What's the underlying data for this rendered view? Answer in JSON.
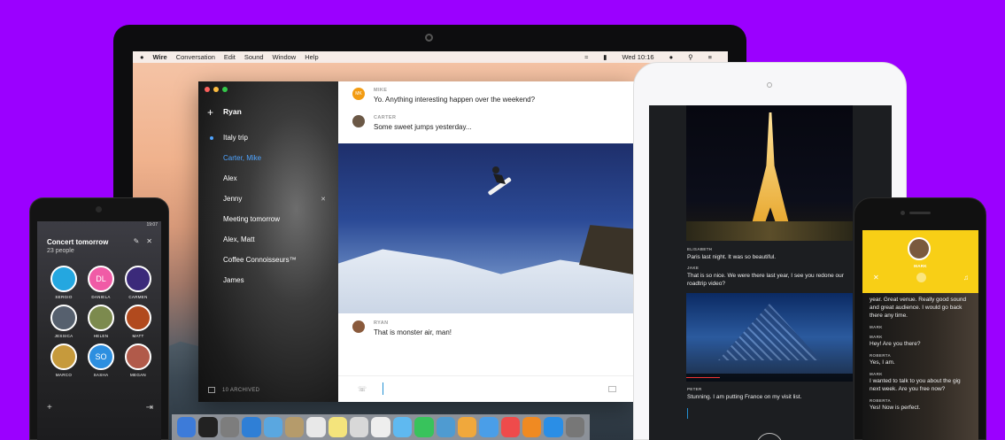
{
  "colors": {
    "background": "#9b00ff",
    "accent": "#4fa4ff",
    "call_yellow": "#f8cf16"
  },
  "laptop": {
    "menubar": {
      "apple_icon": "apple-icon",
      "app": "Wire",
      "menus": [
        "Conversation",
        "Edit",
        "Sound",
        "Window",
        "Help"
      ],
      "clock": "Wed 10:16"
    },
    "wire": {
      "user_name": "Ryan",
      "conversations": [
        {
          "label": "Italy trip",
          "active": false,
          "unread": true
        },
        {
          "label": "Carter, Mike",
          "active": true,
          "unread": false
        },
        {
          "label": "Alex",
          "active": false,
          "unread": false
        },
        {
          "label": "Jenny",
          "active": false,
          "unread": false,
          "muted": true
        },
        {
          "label": "Meeting tomorrow",
          "active": false,
          "unread": false
        },
        {
          "label": "Alex, Matt",
          "active": false,
          "unread": false
        },
        {
          "label": "Coffee Connoisseurs™",
          "active": false,
          "unread": false
        },
        {
          "label": "James",
          "active": false,
          "unread": false
        }
      ],
      "archived_label": "10 ARCHIVED",
      "messages": [
        {
          "sender": "MIKE",
          "initials": "MK",
          "avatar_color": "#f39c12",
          "text": "Yo. Anything interesting happen over the weekend?"
        },
        {
          "sender": "CARTER",
          "initials": "",
          "avatar_color": "#6b5846",
          "text": "Some sweet jumps yesterday..."
        },
        {
          "sender": "RYAN",
          "initials": "",
          "avatar_color": "#8a5a3c",
          "text": "That is monster air, man!"
        }
      ]
    },
    "dock_colors": [
      "#3d7bd9",
      "#222222",
      "#7d7d7d",
      "#2f7fd6",
      "#5aa7e0",
      "#b59b6b",
      "#e8e8e8",
      "#f4e47c",
      "#d8d8d8",
      "#eeeeee",
      "#5fb9f0",
      "#38c35c",
      "#4f9bd1",
      "#f0a83c",
      "#4a9ee8",
      "#ef4b4b",
      "#f08a22",
      "#2a8ee6",
      "#777777"
    ]
  },
  "android": {
    "clock": "19:07",
    "title": "Concert tomorrow",
    "subtitle": "23 people",
    "people": [
      {
        "name": "SERGIO",
        "initials": "",
        "color": "#24a7e0"
      },
      {
        "name": "DANIELA",
        "initials": "DL",
        "color": "#f05ba6"
      },
      {
        "name": "CARMEN",
        "initials": "",
        "color": "#3b2a7a"
      },
      {
        "name": "JESSICA",
        "initials": "",
        "color": "#56606e"
      },
      {
        "name": "HELEN",
        "initials": "",
        "color": "#7c8a4e"
      },
      {
        "name": "MATT",
        "initials": "",
        "color": "#b14a1e"
      },
      {
        "name": "MARCO",
        "initials": "",
        "color": "#c69a3c"
      },
      {
        "name": "SASHA",
        "initials": "SO",
        "color": "#2d8fe0"
      },
      {
        "name": "MEGAN",
        "initials": "",
        "color": "#b15a4a"
      }
    ]
  },
  "ipad": {
    "messages": [
      {
        "sender": "ELISABETH",
        "text": "Paris last night. It was so beautiful."
      },
      {
        "sender": "JAKE",
        "text": "That is so nice. We were there last year, I see you redone our roadtrip video?"
      },
      {
        "sender": "PETER",
        "text": "Stunning. I am putting France on my visit list."
      }
    ],
    "video_progress": 0.2
  },
  "iphone": {
    "caller": "MARK",
    "intro": "year. Great venue. Really good sound and great audience. I would go back there any time.",
    "messages": [
      {
        "sender": "MARK",
        "text": ""
      },
      {
        "sender": "MARK",
        "text": "Hey! Are you there?"
      },
      {
        "sender": "ROBERTA",
        "text": "Yes, I am."
      },
      {
        "sender": "MARK",
        "text": "I wanted to talk to you about the gig next week. Are you free now?"
      },
      {
        "sender": "ROBERTA",
        "text": "Yes! Now is perfect."
      }
    ]
  }
}
